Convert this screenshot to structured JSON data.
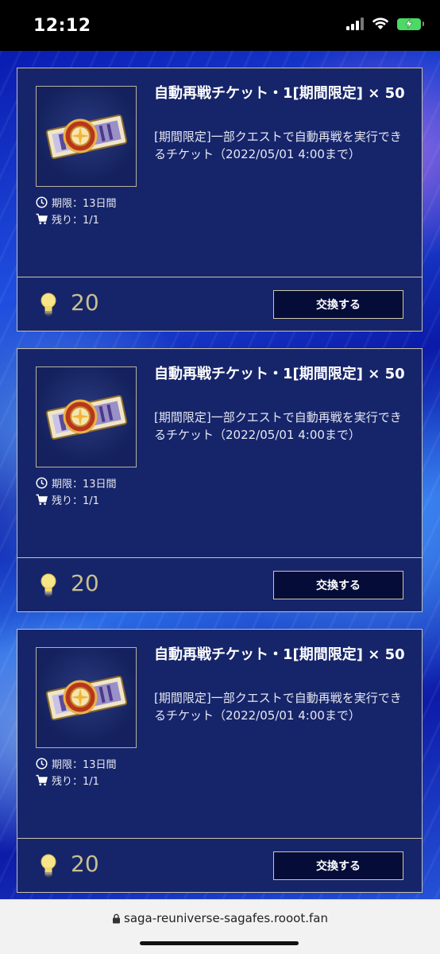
{
  "status_bar": {
    "time": "12:12",
    "icons": [
      "signal-icon",
      "wifi-icon",
      "battery-charging-icon"
    ]
  },
  "colors": {
    "card_bg": "#16256a",
    "card_border": "#c9c3a8",
    "price_text": "#c9bf8f",
    "button_bg": "#050c38",
    "battery": "#4cd964"
  },
  "items": [
    {
      "title": "自動再戦チケット・1[期間限定] × 50",
      "description": "[期間限定]一部クエストで自動再戦を実行できるチケット（2022/05/01 4:00まで）",
      "limit": "期限：13日間",
      "remaining": "残り：1/1",
      "price": "20",
      "button_label": "交換する"
    },
    {
      "title": "自動再戦チケット・1[期間限定] × 50",
      "description": "[期間限定]一部クエストで自動再戦を実行できるチケット（2022/05/01 4:00まで）",
      "limit": "期限：13日間",
      "remaining": "残り：1/1",
      "price": "20",
      "button_label": "交換する"
    },
    {
      "title": "自動再戦チケット・1[期間限定] × 50",
      "description": "[期間限定]一部クエストで自動再戦を実行できるチケット（2022/05/01 4:00まで）",
      "limit": "期限：13日間",
      "remaining": "残り：1/1",
      "price": "20",
      "button_label": "交換する"
    }
  ],
  "browser": {
    "url": "saga-reuniverse-sagafes.rooot.fan"
  }
}
